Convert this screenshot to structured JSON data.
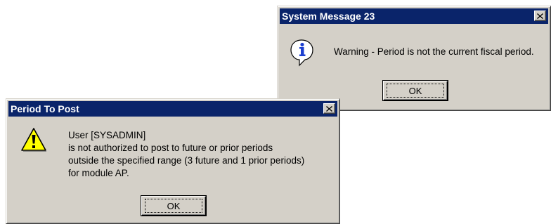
{
  "system_message_dialog": {
    "title": "System Message 23",
    "message": "Warning - Period is not the current fiscal period.",
    "ok_label": "OK",
    "icon": "info-icon"
  },
  "period_to_post_dialog": {
    "title": "Period To Post",
    "message_lines": [
      "User [SYSADMIN]",
      "is not authorized to post to future or prior periods",
      "outside the specified range (3 future and 1 prior periods)",
      "for module AP."
    ],
    "ok_label": "OK",
    "icon": "warning-icon"
  },
  "colors": {
    "titlebar": "#0a246a",
    "dialog_face": "#d4d0c8",
    "warning_yellow": "#ffff00",
    "info_blue": "#1c3fd0"
  }
}
